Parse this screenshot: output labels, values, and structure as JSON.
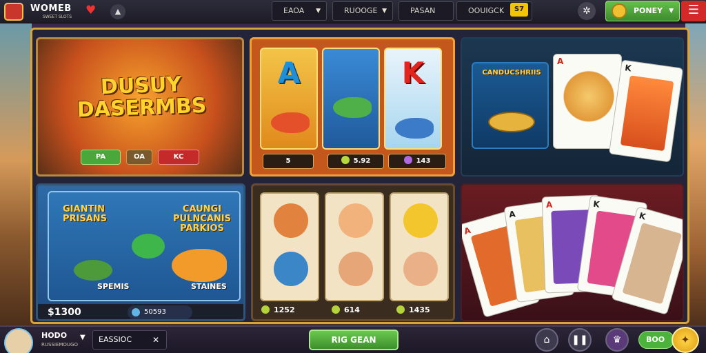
{
  "header": {
    "logo_title": "WOMEB",
    "logo_subtitle": "SWEET SLOTS",
    "dropdowns": [
      "EAOA",
      "RUOOGE",
      "PASAN",
      "OOUIGCK"
    ],
    "coins_badge": "S7",
    "money_label": "PONEY"
  },
  "tiles": {
    "t1": {
      "title_line1": "DUSUY",
      "title_line2": "DASERMBS",
      "buttons": [
        "PA",
        "OA",
        "KC"
      ]
    },
    "t2": {
      "letters": [
        "A",
        "",
        "K"
      ],
      "values": [
        "5",
        "5.92",
        "143"
      ]
    },
    "t3": {
      "panel_title": "CANDUCSHRIIS",
      "card1_corner": "A",
      "card2_corner": "K"
    },
    "t4": {
      "title_left": "GIANTIN PRISANS",
      "title_right": "CAUNGI PULNCANIS PARKIOS",
      "label_left": "SPEMIS",
      "label_right": "STAINES",
      "value_left": "$1300",
      "value_right": "50593"
    },
    "t5": {
      "values": [
        "1252",
        "614",
        "1435"
      ]
    },
    "t6": {
      "cards": [
        "A",
        "A",
        "A",
        "K",
        "K"
      ]
    }
  },
  "footer": {
    "player_name": "HODO",
    "player_sub": "RUSSIEMOUGO",
    "dropdown_label": "EASSIOC",
    "play_button": "RIG GEAN",
    "green_pill": "BOO"
  },
  "colors": {
    "accent_gold": "#d9a33b",
    "play_green": "#4bb33c",
    "menu_red": "#d22a2a"
  }
}
